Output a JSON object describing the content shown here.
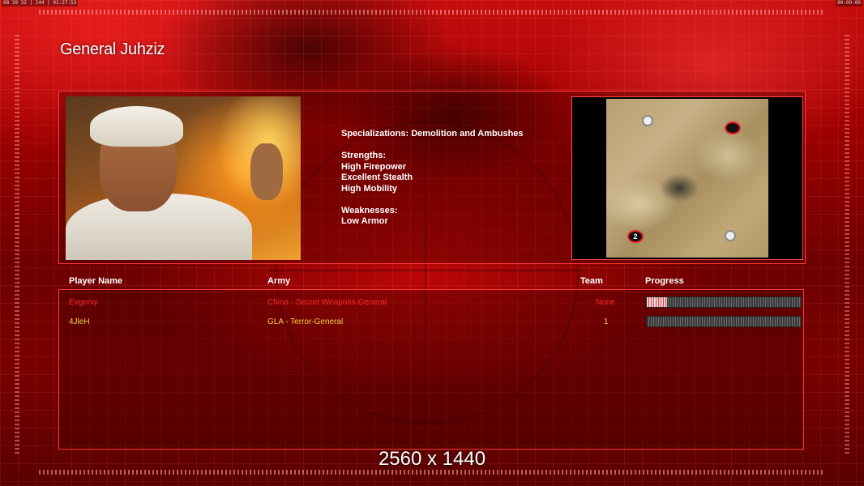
{
  "hud": {
    "top_left_readout": "08 30 32 | 144 | 01:27:53",
    "top_right_readout": "00:00:00"
  },
  "general": {
    "name": "General Juhziz",
    "specializations": "Specializations: Demolition and Ambushes",
    "strengths_label": "Strengths:",
    "strengths": [
      "High Firepower",
      "Excellent Stealth",
      "High Mobility"
    ],
    "weaknesses_label": "Weaknesses:",
    "weaknesses": [
      "Low Armor"
    ]
  },
  "map": {
    "start_marker_label": "2"
  },
  "players_table": {
    "headers": {
      "player_name": "Player Name",
      "army": "Army",
      "team": "Team",
      "progress": "Progress"
    },
    "rows": [
      {
        "player": "Evgeniy",
        "army": "China - Secret Weapons General",
        "team": "None",
        "progress": 0.13,
        "color": "#ff2a2a"
      },
      {
        "player": "4JleH",
        "army": "GLA - Terror-General",
        "team": "1",
        "progress": 0.0,
        "color": "#f2d040"
      }
    ]
  },
  "overlay": {
    "resolution_text": "2560 x 1440"
  },
  "colors": {
    "accent_red": "#ff3a3a",
    "player1": "#ff2a2a",
    "player2": "#f2d040"
  }
}
